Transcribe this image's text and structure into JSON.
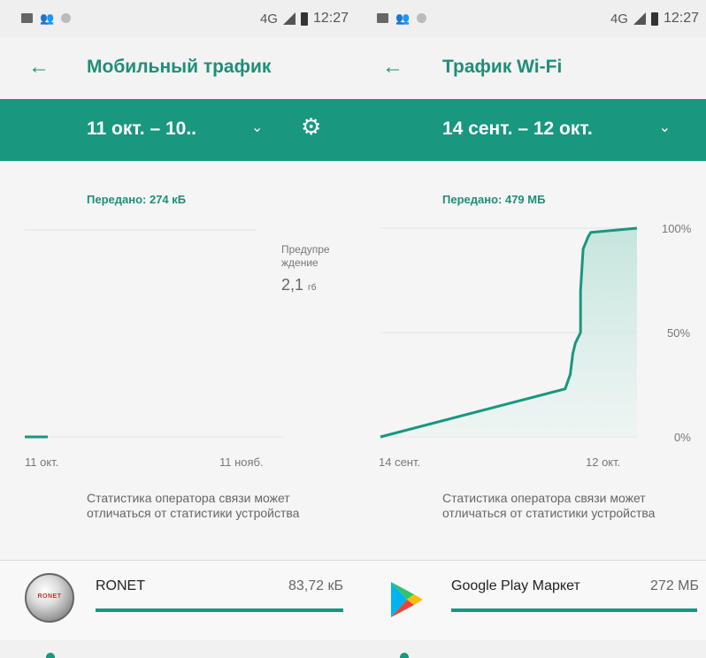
{
  "status_bar": {
    "network": "4G",
    "time": "12:27"
  },
  "left": {
    "title": "Мобильный трафик",
    "date_range": "11 окт. – 10..",
    "transferred": "Передано: 274 кБ",
    "warning_label": "Предупре ждение",
    "warning_value": "2,1",
    "warning_unit": "гб",
    "x_start": "11 окт.",
    "x_end": "11 нояб.",
    "note": "Статистика оператора связи может отличаться от статистики устройства",
    "app": {
      "name": "RONET",
      "logo_text": "RONET",
      "size": "83,72 кБ",
      "usage_fraction": 1.0
    }
  },
  "right": {
    "title": "Трафик Wi-Fi",
    "date_range": "14 сент. – 12 окт.",
    "transferred": "Передано: 479 МБ",
    "y_top": "100%",
    "y_mid": "50%",
    "y_bottom": "0%",
    "x_start": "14 сент.",
    "x_end": "12 окт.",
    "note": "Статистика оператора связи может отличаться от статистики устройства",
    "app": {
      "name": "Google Play Маркет",
      "size": "272 МБ",
      "usage_fraction": 1.0
    }
  },
  "icons": {
    "back": "arrow-left-icon",
    "dropdown": "chevron-down-icon",
    "settings": "gear-icon"
  },
  "colors": {
    "accent": "#19977f",
    "title_text": "#1f8e79"
  },
  "chart_data": [
    {
      "type": "line",
      "x_labels": [
        "11 окт.",
        "11 нояб."
      ],
      "annotation": "Предупре ждение 2,1 гб",
      "series": [
        {
          "values": [
            0.01,
            0.01
          ]
        }
      ]
    },
    {
      "type": "area",
      "x_labels": [
        "14 сент.",
        "12 окт."
      ],
      "y_tick_labels": [
        "0%",
        "50%",
        "100%"
      ],
      "ylim": [
        0,
        100
      ],
      "series": [
        {
          "x": [
            0,
            0.72,
            0.74,
            0.75,
            0.76,
            0.78,
            0.78,
            0.79,
            0.81,
            0.82,
            1.0
          ],
          "y": [
            0,
            23,
            30,
            40,
            45,
            50,
            70,
            90,
            96,
            98,
            100
          ]
        }
      ]
    }
  ]
}
